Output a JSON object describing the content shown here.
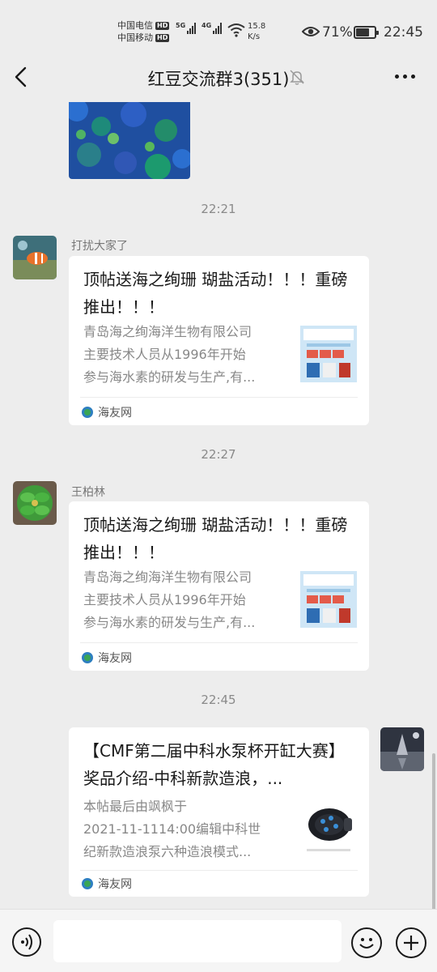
{
  "status_bar": {
    "carrier1": "中国电信",
    "carrier2": "中国移动",
    "hd": "HD",
    "sig1_tag": "5G",
    "sig2_tag": "4G",
    "net_speed_value": "15.8",
    "net_speed_unit": "K/s",
    "battery_percent": "71%",
    "battery_level": 0.71,
    "time": "22:45"
  },
  "nav": {
    "title": "红豆交流群3(351)"
  },
  "messages": {
    "time1": "22:21",
    "time2": "22:27",
    "time3": "22:45",
    "msg1": {
      "sender": "打扰大家了",
      "title": "顶帖送海之绚珊 瑚盐活动！！！重磅推出！！！",
      "desc_line1": "青岛海之绚海洋生物有限公司",
      "desc_line2": "主要技术人员从1996年开始",
      "desc_line3": "参与海水素的研发与生产,有...",
      "source": "海友网"
    },
    "msg2": {
      "sender": "王柏林",
      "title": "顶帖送海之绚珊 瑚盐活动！！！重磅推出！！！",
      "desc_line1": "青岛海之绚海洋生物有限公司",
      "desc_line2": "主要技术人员从1996年开始",
      "desc_line3": "参与海水素的研发与生产,有...",
      "source": "海友网"
    },
    "msg3": {
      "title": "【CMF第二届中科水泵杯开缸大赛】奖品介绍-中科新款造浪，...",
      "desc_line1": "本帖最后由飒枫于",
      "desc_line2": "2021-11-1114:00编辑中科世",
      "desc_line3": "纪新款造浪泵六种造浪模式...",
      "source": "海友网"
    }
  },
  "colors": {
    "background": "#ededed",
    "card": "#ffffff",
    "text": "#191919",
    "muted": "#888888"
  }
}
